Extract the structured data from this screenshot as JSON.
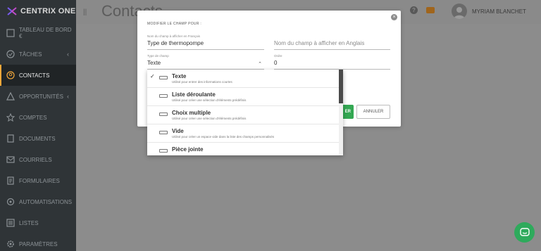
{
  "app": {
    "name": "CENTRIX ONE"
  },
  "sidebar": {
    "items": [
      {
        "label": "TABLEAU DE BORD €",
        "icon": "dashboard-icon",
        "chevron": ""
      },
      {
        "label": "TÂCHES",
        "icon": "tasks-icon",
        "chevron": "‹"
      },
      {
        "label": "CONTACTS",
        "icon": "contacts-icon",
        "chevron": "",
        "active": true
      },
      {
        "label": "OPPORTUNITÉS",
        "icon": "opportunities-icon",
        "chevron": "‹"
      },
      {
        "label": "COMPTES",
        "icon": "star-icon",
        "chevron": ""
      },
      {
        "label": "DOCUMENTS",
        "icon": "document-icon",
        "chevron": ""
      },
      {
        "label": "COURRIELS",
        "icon": "mail-icon",
        "chevron": ""
      },
      {
        "label": "FORMULAIRES",
        "icon": "form-icon",
        "chevron": ""
      },
      {
        "label": "AUTOMATISATIONS",
        "icon": "automation-icon",
        "chevron": ""
      },
      {
        "label": "LISTES",
        "icon": "list-icon",
        "chevron": ""
      },
      {
        "label": "PARAMÈTRES",
        "icon": "settings-icon",
        "chevron": ""
      }
    ]
  },
  "header": {
    "page_title": "Contacts",
    "user_name": "MYRIAM BLANCHET",
    "help_glyph": "?"
  },
  "modal": {
    "title": "MODIFIER LE CHAMP POUR :",
    "close_glyph": "×",
    "fields": {
      "name_fr_label": "Nom du champ à afficher en Français",
      "name_fr_value": "Type de thermopompe",
      "name_en_placeholder": "Nom du champ à afficher en Anglais",
      "type_label": "Type de champ",
      "type_value": "Texte",
      "order_label": "Ordre",
      "order_value": "0"
    },
    "save_label": "ER",
    "cancel_label": "ANNULER"
  },
  "dropdown": {
    "options": [
      {
        "label": "Texte",
        "desc": "Utilisé pour entrer des informations courtes",
        "selected": true
      },
      {
        "label": "Liste déroulante",
        "desc": "Utilisé pour créer une sélection d'éléments prédéfinis",
        "selected": false
      },
      {
        "label": "Choix multiple",
        "desc": "Utilisé pour créer une sélection d'éléments prédéfinis",
        "selected": false
      },
      {
        "label": "Vide",
        "desc": "Utilisé pour créer un espace vide dans la liste des champs personnalisés",
        "selected": false
      },
      {
        "label": "Pièce jointe",
        "desc": "",
        "selected": false
      }
    ],
    "check_glyph": "✓"
  },
  "colors": {
    "sidebar_bg": "#2f3437",
    "accent": "#f2a73a",
    "save_green": "#34a853",
    "chat_green": "#2eaa5c"
  }
}
